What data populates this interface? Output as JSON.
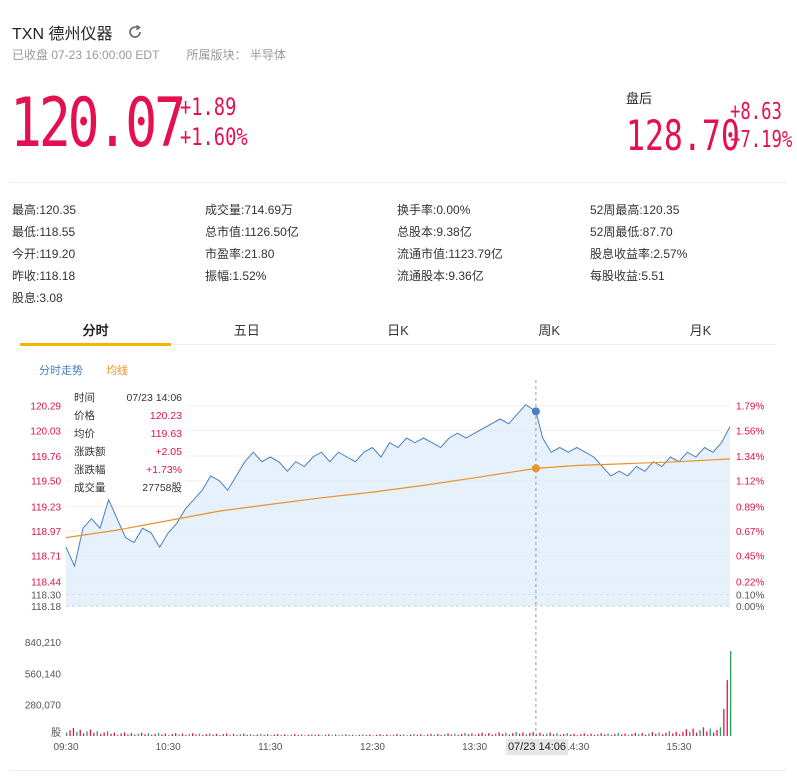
{
  "header": {
    "title": "TXN 德州仪器",
    "status": "已收盘 07-23 16:00:00 EDT",
    "sector": "所属版块： 半导体"
  },
  "quote": {
    "price": "120.07",
    "change": "+1.89",
    "change_pct": "+1.60%",
    "after_label": "盘后",
    "after_price": "128.70",
    "after_change": "+8.63",
    "after_change_pct": "+7.19%"
  },
  "stats": [
    [
      "最高:120.35",
      "最低:118.55",
      "今开:119.20",
      "昨收:118.18",
      "股息:3.08"
    ],
    [
      "成交量:714.69万",
      "总市值:1126.50亿",
      "市盈率:21.80",
      "振幅:1.52%"
    ],
    [
      "换手率:0.00%",
      "总股本:9.38亿",
      "流通市值:1123.79亿",
      "流通股本:9.36亿"
    ],
    [
      "52周最高:120.35",
      "52周最低:87.70",
      "股息收益率:2.57%",
      "每股收益:5.51"
    ]
  ],
  "tabs": [
    "分时",
    "五日",
    "日K",
    "周K",
    "月K"
  ],
  "legend": {
    "trend": "分时走势",
    "avg": "均线"
  },
  "axis": {
    "price_ticks": [
      "120.29",
      "120.03",
      "119.76",
      "119.50",
      "119.23",
      "118.97",
      "118.71",
      "118.44",
      "118.30",
      "118.18"
    ],
    "pct_ticks": [
      "1.79%",
      "1.56%",
      "1.34%",
      "1.12%",
      "0.89%",
      "0.67%",
      "0.45%",
      "0.22%",
      "0.10%",
      "0.00%"
    ],
    "volume_ticks": [
      "840,210",
      "560,140",
      "280,070",
      "股"
    ],
    "time_ticks": [
      "09:30",
      "10:30",
      "11:30",
      "12:30",
      "13:30",
      "14:30",
      "15:30"
    ],
    "cursor_time": "07/23 14:06"
  },
  "tooltip": [
    {
      "k": "时间",
      "v": "07/23 14:06"
    },
    {
      "k": "价格",
      "v": "120.23"
    },
    {
      "k": "均价",
      "v": "119.63"
    },
    {
      "k": "涨跌额",
      "v": "+2.05"
    },
    {
      "k": "涨跌幅",
      "v": "+1.73%"
    },
    {
      "k": "成交量",
      "v": "27758股"
    }
  ],
  "colors": {
    "up": "#e3114f",
    "line": "#4a7fc1",
    "avg": "#e8932b",
    "fill": "#dcebfa"
  },
  "chart_data": {
    "type": "line",
    "x_range": [
      "09:30",
      "16:00"
    ],
    "ylim": [
      118.18,
      120.35
    ],
    "price_series": [
      [
        "09:30",
        118.8
      ],
      [
        "09:35",
        118.6
      ],
      [
        "09:40",
        119.0
      ],
      [
        "09:45",
        119.1
      ],
      [
        "09:50",
        119.0
      ],
      [
        "09:55",
        119.3
      ],
      [
        "10:00",
        119.1
      ],
      [
        "10:05",
        118.9
      ],
      [
        "10:10",
        118.85
      ],
      [
        "10:15",
        119.0
      ],
      [
        "10:20",
        118.95
      ],
      [
        "10:25",
        118.8
      ],
      [
        "10:30",
        118.95
      ],
      [
        "10:35",
        119.05
      ],
      [
        "10:40",
        119.2
      ],
      [
        "10:45",
        119.3
      ],
      [
        "10:50",
        119.4
      ],
      [
        "10:55",
        119.55
      ],
      [
        "11:00",
        119.5
      ],
      [
        "11:05",
        119.4
      ],
      [
        "11:10",
        119.55
      ],
      [
        "11:15",
        119.7
      ],
      [
        "11:20",
        119.8
      ],
      [
        "11:25",
        119.7
      ],
      [
        "11:30",
        119.75
      ],
      [
        "11:35",
        119.7
      ],
      [
        "11:40",
        119.6
      ],
      [
        "11:45",
        119.7
      ],
      [
        "11:50",
        119.65
      ],
      [
        "11:55",
        119.75
      ],
      [
        "12:00",
        119.8
      ],
      [
        "12:05",
        119.7
      ],
      [
        "12:10",
        119.8
      ],
      [
        "12:15",
        119.75
      ],
      [
        "12:20",
        119.7
      ],
      [
        "12:25",
        119.8
      ],
      [
        "12:30",
        119.85
      ],
      [
        "12:35",
        119.75
      ],
      [
        "12:40",
        119.9
      ],
      [
        "12:45",
        119.85
      ],
      [
        "12:50",
        119.95
      ],
      [
        "12:55",
        119.9
      ],
      [
        "13:00",
        119.95
      ],
      [
        "13:05",
        119.9
      ],
      [
        "13:10",
        119.85
      ],
      [
        "13:15",
        119.95
      ],
      [
        "13:20",
        120.0
      ],
      [
        "13:25",
        119.95
      ],
      [
        "13:30",
        120.0
      ],
      [
        "13:35",
        120.05
      ],
      [
        "13:40",
        120.1
      ],
      [
        "13:45",
        120.15
      ],
      [
        "13:50",
        120.1
      ],
      [
        "13:55",
        120.2
      ],
      [
        "14:00",
        120.3
      ],
      [
        "14:06",
        120.23
      ],
      [
        "14:10",
        119.95
      ],
      [
        "14:15",
        119.8
      ],
      [
        "14:20",
        119.85
      ],
      [
        "14:25",
        119.8
      ],
      [
        "14:30",
        119.85
      ],
      [
        "14:35",
        119.8
      ],
      [
        "14:40",
        119.75
      ],
      [
        "14:45",
        119.65
      ],
      [
        "14:50",
        119.55
      ],
      [
        "14:55",
        119.6
      ],
      [
        "15:00",
        119.55
      ],
      [
        "15:05",
        119.65
      ],
      [
        "15:10",
        119.6
      ],
      [
        "15:15",
        119.7
      ],
      [
        "15:20",
        119.65
      ],
      [
        "15:25",
        119.75
      ],
      [
        "15:30",
        119.7
      ],
      [
        "15:35",
        119.8
      ],
      [
        "15:40",
        119.75
      ],
      [
        "15:45",
        119.85
      ],
      [
        "15:50",
        119.8
      ],
      [
        "15:55",
        119.9
      ],
      [
        "16:00",
        120.07
      ]
    ],
    "avg_series": [
      [
        "09:30",
        118.9
      ],
      [
        "10:00",
        118.98
      ],
      [
        "10:30",
        119.08
      ],
      [
        "11:00",
        119.18
      ],
      [
        "11:30",
        119.25
      ],
      [
        "12:00",
        119.32
      ],
      [
        "12:30",
        119.38
      ],
      [
        "13:00",
        119.45
      ],
      [
        "13:30",
        119.53
      ],
      [
        "14:06",
        119.63
      ],
      [
        "14:30",
        119.66
      ],
      [
        "15:00",
        119.68
      ],
      [
        "15:30",
        119.7
      ],
      [
        "16:00",
        119.73
      ]
    ],
    "volume": [
      [
        "09:30",
        60000
      ],
      [
        "10:00",
        25000
      ],
      [
        "10:30",
        20000
      ],
      [
        "11:00",
        18000
      ],
      [
        "11:30",
        14000
      ],
      [
        "12:00",
        12000
      ],
      [
        "12:30",
        12000
      ],
      [
        "13:00",
        14000
      ],
      [
        "13:30",
        22000
      ],
      [
        "14:00",
        30000
      ],
      [
        "14:30",
        18000
      ],
      [
        "15:00",
        20000
      ],
      [
        "15:30",
        35000
      ],
      [
        "15:55",
        110000
      ],
      [
        "16:00",
        760000
      ]
    ]
  }
}
